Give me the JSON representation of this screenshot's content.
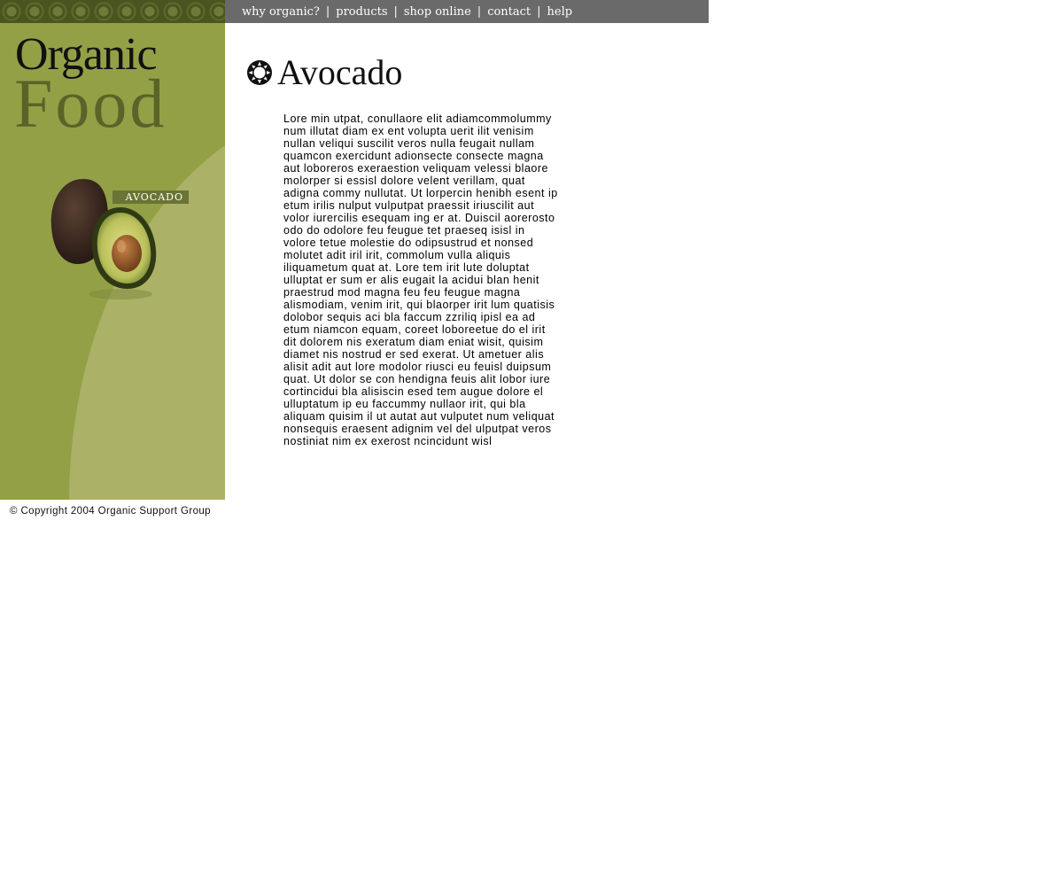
{
  "nav": {
    "items": [
      "why organic?",
      "products",
      "shop online",
      "contact",
      "help"
    ],
    "separator": "|"
  },
  "brand": {
    "line1": "Organic",
    "line2": "Food"
  },
  "sidebar": {
    "product_tag": "AVOCADO",
    "product_image_icon": "avocado-illustration"
  },
  "main": {
    "title_icon": "sun-icon",
    "title": "Avocado",
    "body": "Lore min utpat, conullaore elit adiamcommolummy num illutat diam ex ent volupta uerit ilit venisim nullan veliqui suscilit veros nulla feugait nullam quamcon exercidunt adionsecte consecte magna aut loboreros exeraestion veliquam velessi blaore molorper si essisl dolore velent verillam, quat adigna commy nullutat. Ut lorpercin henibh esent ip etum irilis nulput vulputpat praessit iriuscilit aut volor iurercilis esequam ing er at. Duiscil aorerosto odo do odolore feu feugue tet praeseq isisl in volore tetue molestie do odipsustrud et nonsed molutet adit iril irit, commolum vulla aliquis iliquametum quat at. Lore tem irit lute doluptat ulluptat er sum er alis eugait la acidui blan henit praestrud mod magna feu feu feugue magna alismodiam, venim irit, qui blaorper irit lum quatisis dolobor sequis aci bla faccum zzriliq ipisl ea ad etum niamcon equam, coreet loboreetue do el irit dit dolorem nis exeratum diam eniat wisit, quisim diamet nis nostrud er sed exerat. Ut ametuer alis alisit adit aut lore modolor riusci eu feuisl duipsum quat. Ut dolor se con hendigna feuis alit lobor iure cortincidui bla alisiscin esed tem augue dolore el ulluptatum ip eu faccummy nullaor irit, qui bla aliquam quisim il ut autat aut vulputet num veliquat nonsequis eraesent adignim vel del ulputpat veros nostiniat nim ex exerost ncincidunt wisl"
  },
  "footer": {
    "copyright": "© Copyright 2004 Organic Support Group"
  },
  "colors": {
    "nav_bar": "#6a6a6a",
    "sidebar_green": "#93a045",
    "sidebar_arc": "#abb166",
    "brand_food": "#5a6328",
    "tag_bg": "#6a7434"
  }
}
